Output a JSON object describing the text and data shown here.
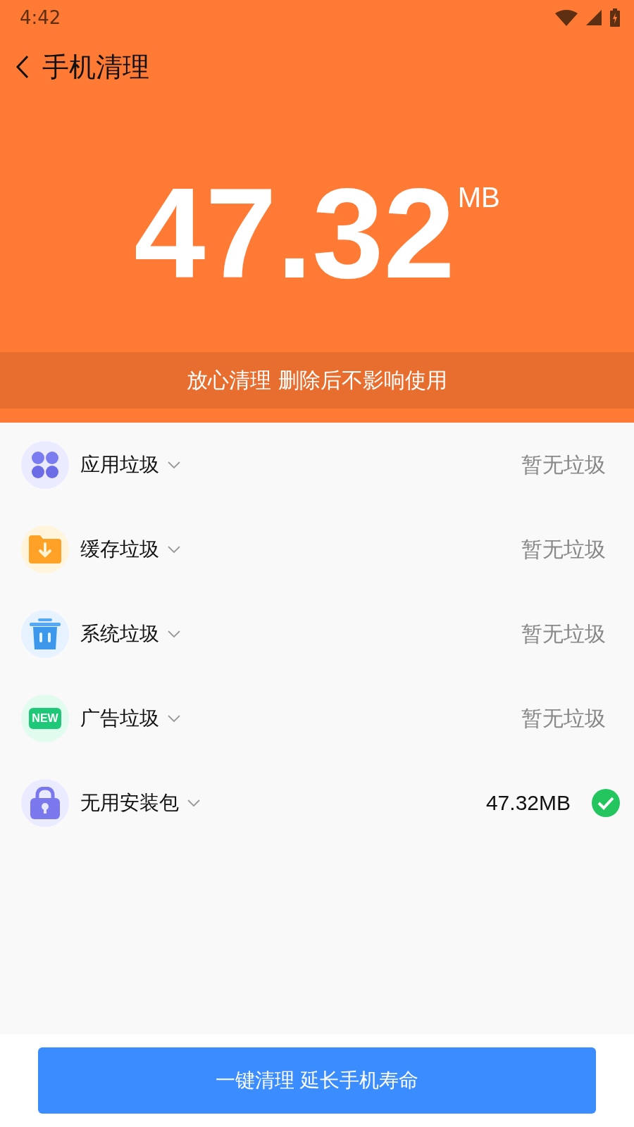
{
  "status_bar": {
    "time": "4:42"
  },
  "header": {
    "title": "手机清理"
  },
  "summary": {
    "amount": "47.32",
    "unit": "MB",
    "note": "放心清理 删除后不影响使用"
  },
  "items": [
    {
      "kind": "apps",
      "label": "应用垃圾",
      "status": "暂无垃圾",
      "checked": false
    },
    {
      "kind": "cache",
      "label": "缓存垃圾",
      "status": "暂无垃圾",
      "checked": false
    },
    {
      "kind": "system",
      "label": "系统垃圾",
      "status": "暂无垃圾",
      "checked": false
    },
    {
      "kind": "ads",
      "label": "广告垃圾",
      "icon_text": "NEW",
      "status": "暂无垃圾",
      "checked": false
    },
    {
      "kind": "package",
      "label": "无用安装包",
      "status": "47.32MB",
      "checked": true
    }
  ],
  "action": {
    "label": "一键清理 延长手机寿命"
  }
}
